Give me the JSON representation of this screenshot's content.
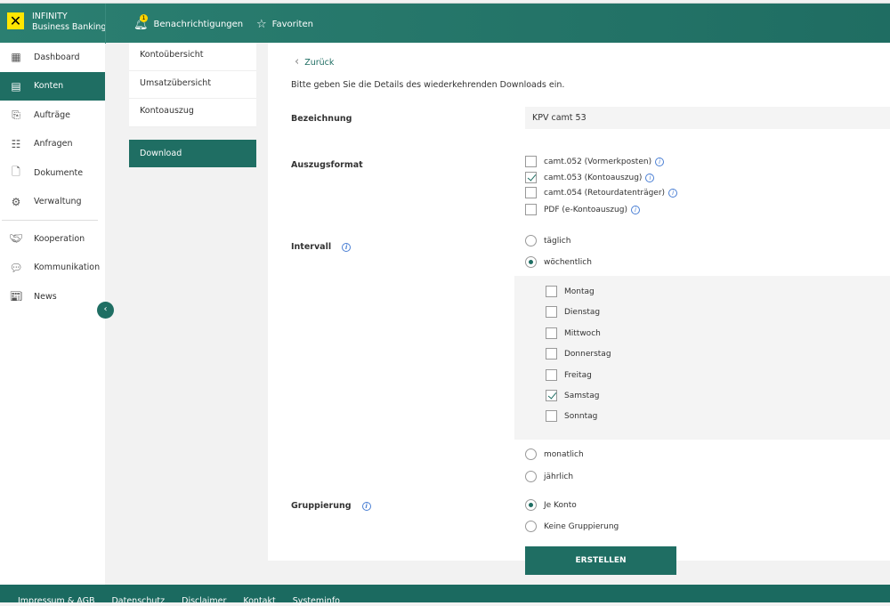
{
  "header": {
    "brand_line1": "INFINITY",
    "brand_line2": "Business Banking",
    "notifications": "Benachrichtigungen",
    "notification_count": "1",
    "favorites": "Favoriten"
  },
  "sidebar": {
    "items": [
      {
        "label": "Dashboard"
      },
      {
        "label": "Konten"
      },
      {
        "label": "Aufträge"
      },
      {
        "label": "Anfragen"
      },
      {
        "label": "Dokumente"
      },
      {
        "label": "Verwaltung"
      },
      {
        "label": "Kooperation"
      },
      {
        "label": "Kommunikation"
      },
      {
        "label": "News"
      }
    ],
    "active": "Konten"
  },
  "submenu": {
    "items": [
      "Kontoübersicht",
      "Umsatzübersicht",
      "Kontoauszug"
    ],
    "download": "Download"
  },
  "form": {
    "back": "Zurück",
    "intro": "Bitte geben Sie die Details des wiederkehrenden Downloads ein.",
    "bezeichnung_label": "Bezeichnung",
    "bezeichnung_value": "KPV camt 53",
    "format_label": "Auszugsformat",
    "formats": [
      {
        "label": "camt.052 (Vormerkposten)",
        "checked": false
      },
      {
        "label": "camt.053 (Kontoauszug)",
        "checked": true
      },
      {
        "label": "camt.054 (Retourdatenträger)",
        "checked": false
      },
      {
        "label": "PDF (e-Kontoauszug)",
        "checked": false
      }
    ],
    "interval_label": "Intervall",
    "intervals": [
      {
        "label": "täglich",
        "selected": false
      },
      {
        "label": "wöchentlich",
        "selected": true
      },
      {
        "label": "monatlich",
        "selected": false
      },
      {
        "label": "jährlich",
        "selected": false
      }
    ],
    "days": [
      {
        "label": "Montag",
        "checked": false
      },
      {
        "label": "Dienstag",
        "checked": false
      },
      {
        "label": "Mittwoch",
        "checked": false
      },
      {
        "label": "Donnerstag",
        "checked": false
      },
      {
        "label": "Freitag",
        "checked": false
      },
      {
        "label": "Samstag",
        "checked": true
      },
      {
        "label": "Sonntag",
        "checked": false
      }
    ],
    "grouping_label": "Gruppierung",
    "groupings": [
      {
        "label": "Je Konto",
        "selected": true
      },
      {
        "label": "Keine Gruppierung",
        "selected": false
      }
    ],
    "submit": "ERSTELLEN"
  },
  "footer": {
    "links": [
      "Impressum & AGB",
      "Datenschutz",
      "Disclaimer",
      "Kontakt",
      "Systeminfo"
    ]
  },
  "colors": {
    "primary": "#1f6e63",
    "logo": "#ffe600"
  }
}
